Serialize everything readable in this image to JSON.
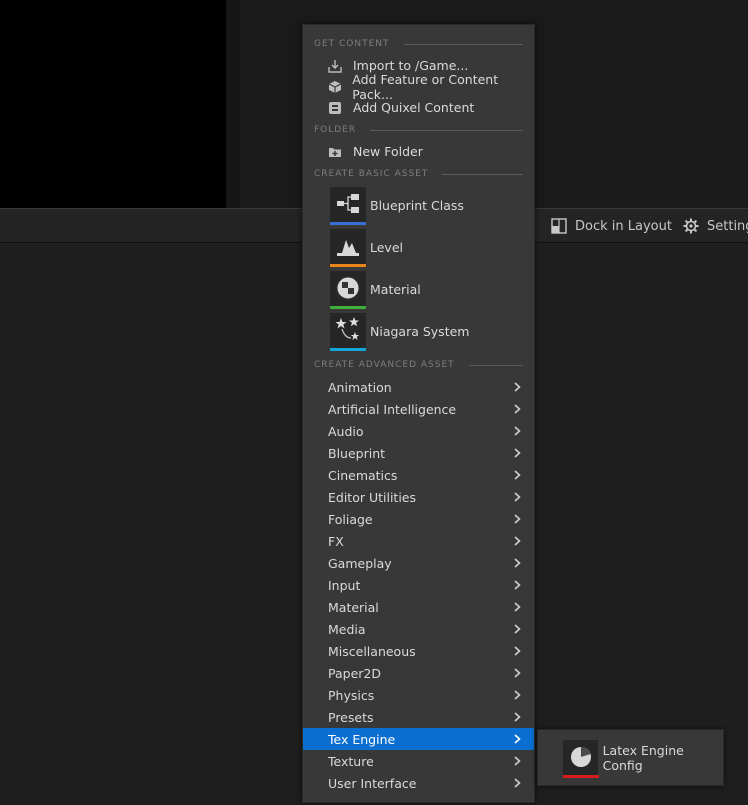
{
  "toolbar": {
    "dock_label": "Dock in Layout",
    "settings_label": "Settings",
    "dock_icon": "dock-layout-icon",
    "settings_icon": "gear-icon"
  },
  "menu": {
    "sections": {
      "get_content": "GET CONTENT",
      "folder": "FOLDER",
      "basic": "CREATE BASIC ASSET",
      "advanced": "CREATE ADVANCED ASSET"
    },
    "get_content_items": [
      {
        "label": "Import to /Game...",
        "icon": "import-icon"
      },
      {
        "label": "Add Feature or Content Pack...",
        "icon": "content-pack-icon"
      },
      {
        "label": "Add Quixel Content",
        "icon": "quixel-icon"
      }
    ],
    "folder_items": [
      {
        "label": "New Folder",
        "icon": "new-folder-icon"
      }
    ],
    "basic_assets": [
      {
        "label": "Blueprint Class",
        "icon": "blueprint-class-icon",
        "color": "#3a6fd8"
      },
      {
        "label": "Level",
        "icon": "level-icon",
        "color": "#e8861c"
      },
      {
        "label": "Material",
        "icon": "material-icon",
        "color": "#3fae3a"
      },
      {
        "label": "Niagara System",
        "icon": "niagara-system-icon",
        "color": "#14a6d8"
      }
    ],
    "advanced_assets": [
      "Animation",
      "Artificial Intelligence",
      "Audio",
      "Blueprint",
      "Cinematics",
      "Editor Utilities",
      "Foliage",
      "FX",
      "Gameplay",
      "Input",
      "Material",
      "Media",
      "Miscellaneous",
      "Paper2D",
      "Physics",
      "Presets",
      "Tex Engine",
      "Texture",
      "User Interface"
    ],
    "active_item": "Tex Engine",
    "highlight_color": "#0a6fd1"
  },
  "submenu": {
    "items": [
      {
        "label": "Latex Engine Config",
        "icon": "latex-engine-config-icon",
        "color": "#d81c1c"
      }
    ]
  }
}
